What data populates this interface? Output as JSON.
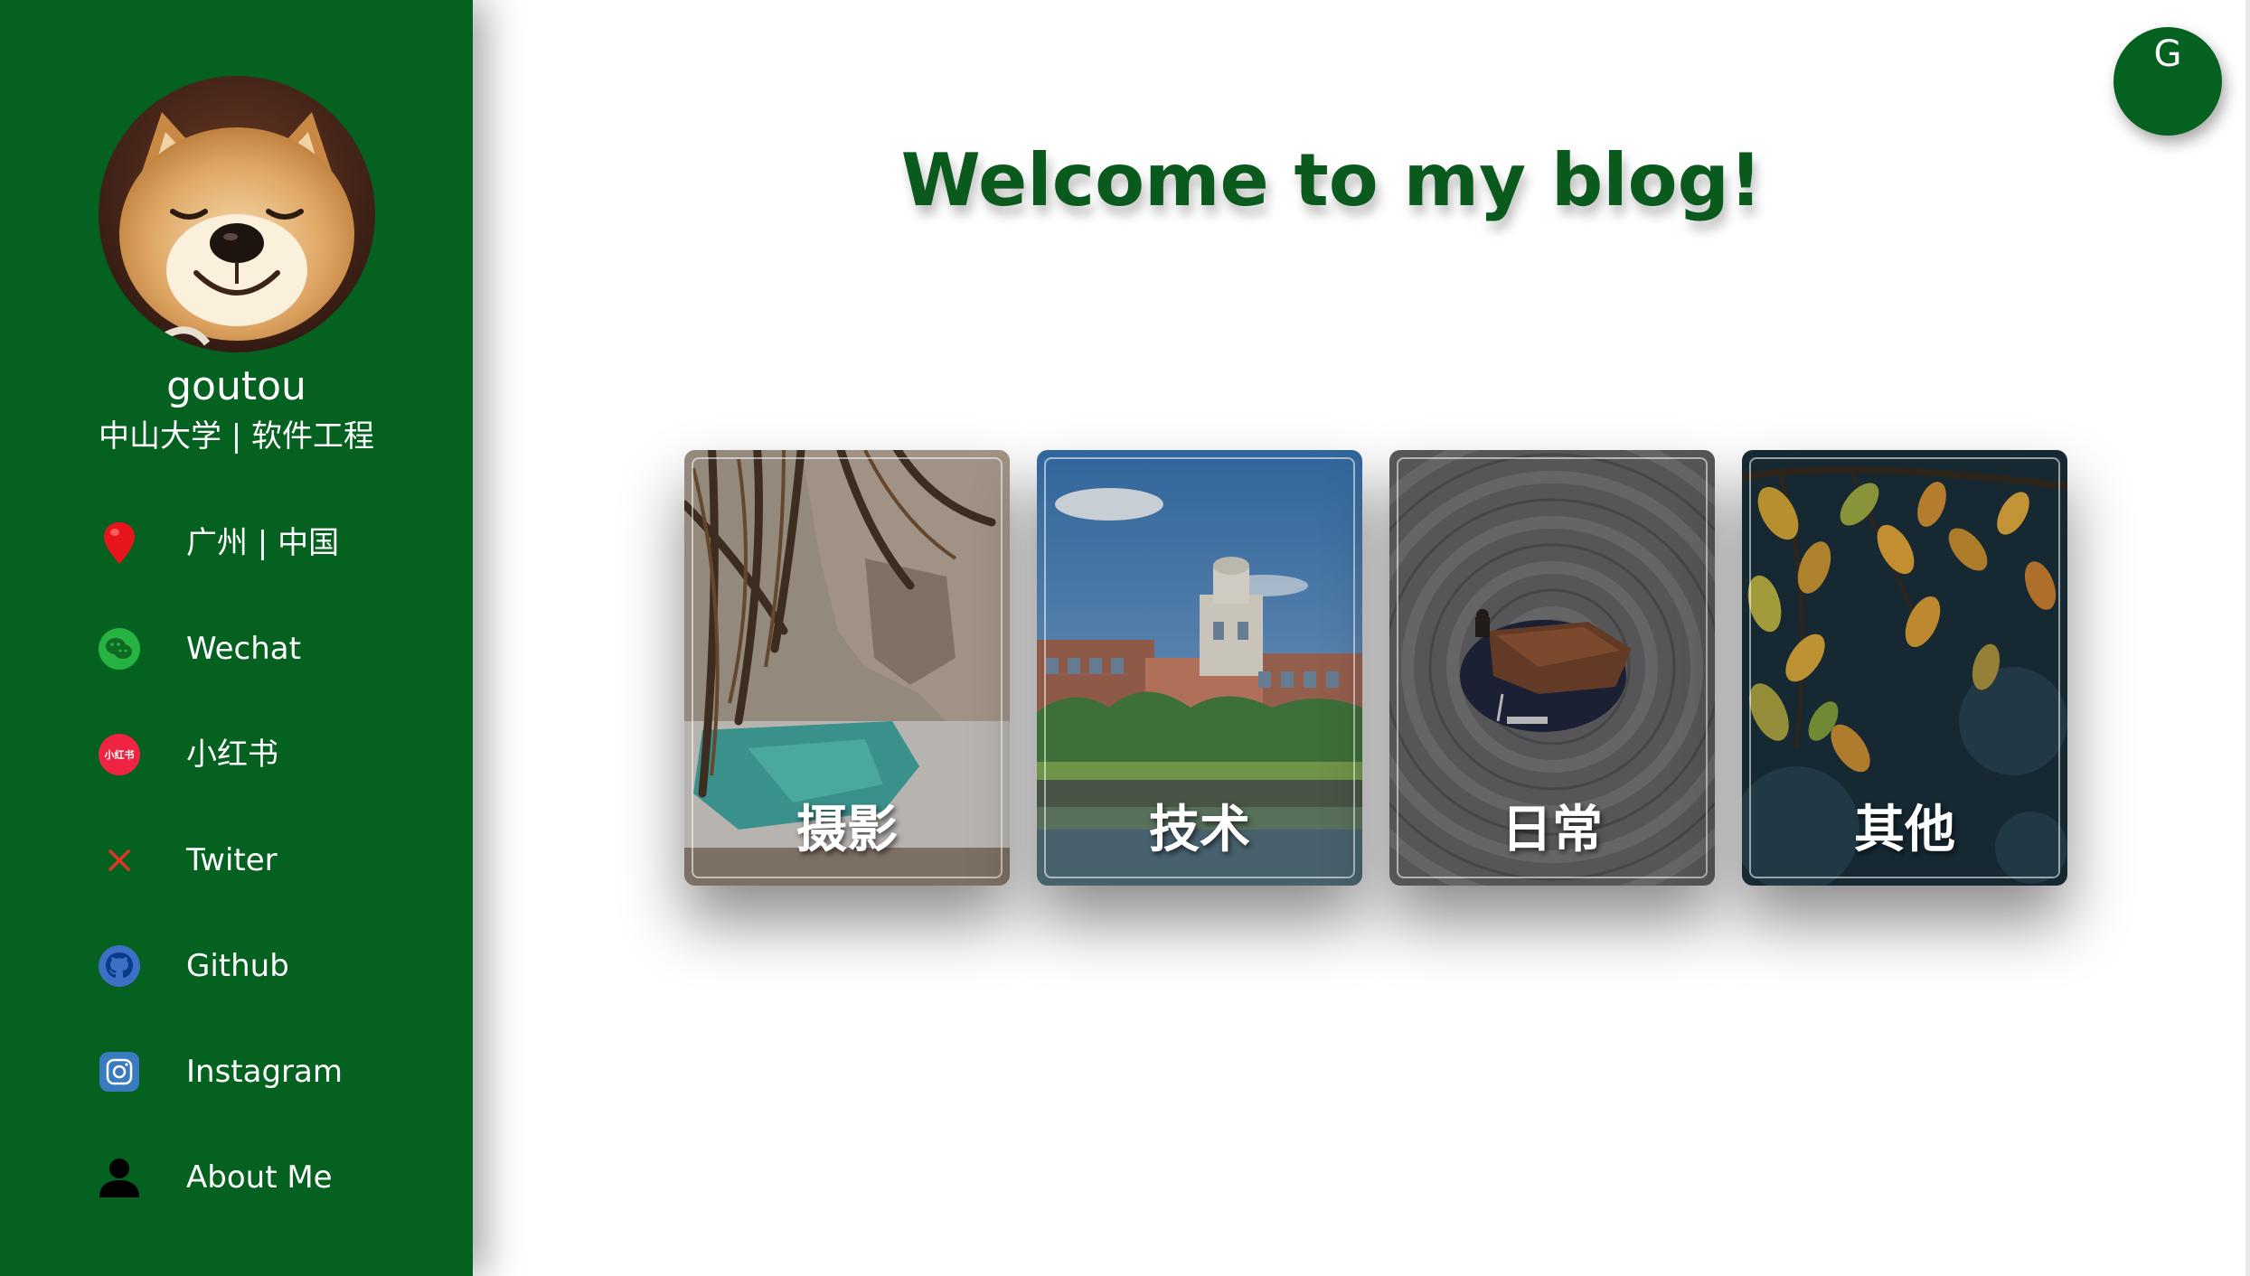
{
  "profile": {
    "name": "goutou",
    "subtitle": "中山大学 | 软件工程"
  },
  "sidebar": {
    "items": [
      {
        "label": "广州 | 中国",
        "icon": "location-pin-icon"
      },
      {
        "label": "Wechat",
        "icon": "wechat-icon"
      },
      {
        "label": "小红书",
        "icon": "xiaohongshu-icon"
      },
      {
        "label": "Twiter",
        "icon": "x-twitter-icon"
      },
      {
        "label": "Github",
        "icon": "github-icon"
      },
      {
        "label": "Instagram",
        "icon": "instagram-icon"
      },
      {
        "label": "About Me",
        "icon": "person-icon"
      }
    ]
  },
  "xhs_badge": "小红书",
  "main": {
    "title": "Welcome to my blog!",
    "fab_label": "G",
    "cards": [
      {
        "label": "摄影"
      },
      {
        "label": "技术"
      },
      {
        "label": "日常"
      },
      {
        "label": "其他"
      }
    ]
  },
  "colors": {
    "sidebar_bg": "#04611f",
    "title": "#0a5a1e",
    "pin": "#e8141b",
    "wechat": "#27b341",
    "xiaohongshu": "#ef2442",
    "x_icon": "#e0342a",
    "github": "#3d6fc4",
    "instagram": "#3a7bbf"
  }
}
